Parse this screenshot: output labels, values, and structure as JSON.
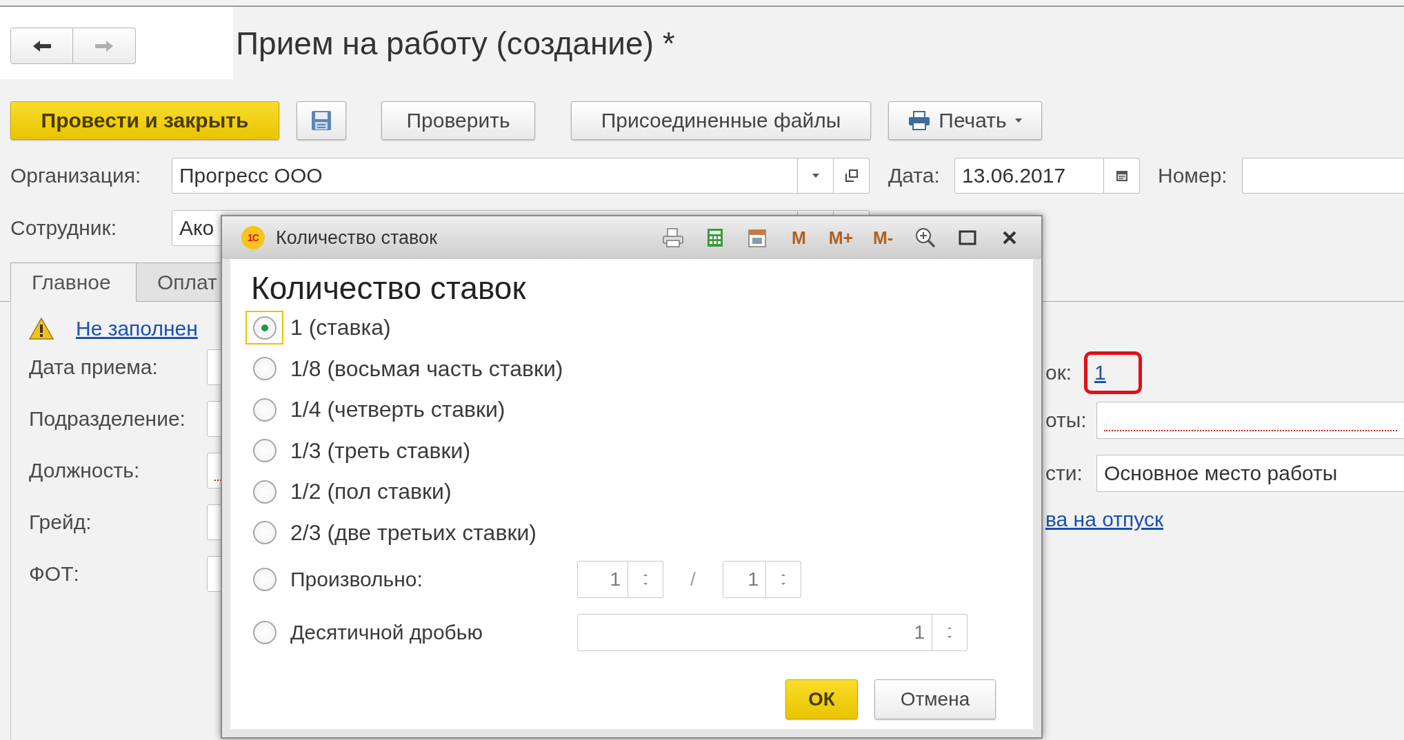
{
  "nav": [
    {
      "kind": "back",
      "disabled": false
    },
    {
      "kind": "forward",
      "disabled": true
    }
  ],
  "title": "Прием на работу (создание) *",
  "toolbar": [
    {
      "kind": "primary",
      "label": "Провести и закрыть"
    },
    {
      "kind": "save"
    },
    {
      "kind": "plain",
      "label": "Проверить"
    },
    {
      "kind": "plain",
      "label": "Присоединенные файлы"
    },
    {
      "kind": "print-menu",
      "label": "Печать"
    }
  ],
  "header": {
    "organization": {
      "label": "Организация:",
      "value": "Прогресс ООО"
    },
    "date": {
      "label": "Дата:",
      "value": "13.06.2017"
    },
    "number": {
      "label": "Номер:"
    },
    "employee": {
      "label": "Сотрудник:",
      "value": "Ако"
    }
  },
  "tabs": [
    {
      "label": "Главное",
      "selected": true
    },
    {
      "label": "Оплат",
      "selected": false
    }
  ],
  "warning": {
    "link": "Не заполнен"
  },
  "left_fields": [
    {
      "label": "Дата приема:",
      "required": false
    },
    {
      "label": "Подразделение:",
      "required": false
    },
    {
      "label": "Должность:",
      "required": true
    },
    {
      "label": "Грейд:",
      "required": false
    },
    {
      "label": "ФОТ:",
      "required": false
    }
  ],
  "right_fields": [
    {
      "kind": "link",
      "label": "ок:",
      "value": "1",
      "highlighted": true
    },
    {
      "kind": "field",
      "label": "оты:",
      "required": true
    },
    {
      "kind": "field",
      "label": "сти:",
      "value": "Основное место работы",
      "required": false
    }
  ],
  "right_link": "ва на отпуск",
  "dialog": {
    "logo": "1С",
    "title": "Количество ставок",
    "tools": [
      {
        "kind": "print"
      },
      {
        "kind": "calculator"
      },
      {
        "kind": "calendar"
      },
      {
        "kind": "memory",
        "label": "M"
      },
      {
        "kind": "memory-add",
        "label": "M+"
      },
      {
        "kind": "memory-subtract",
        "label": "M-"
      },
      {
        "kind": "zoom"
      },
      {
        "kind": "maximize"
      },
      {
        "kind": "close"
      }
    ],
    "heading": "Количество ставок",
    "options": [
      {
        "kind": "plain",
        "label": "1 (ставка)",
        "selected": true
      },
      {
        "kind": "plain",
        "label": "1/8 (восьмая часть ставки)",
        "selected": false
      },
      {
        "kind": "plain",
        "label": "1/4 (четверть ставки)",
        "selected": false
      },
      {
        "kind": "plain",
        "label": "1/3 (треть ставки)",
        "selected": false
      },
      {
        "kind": "plain",
        "label": "1/2 (пол ставки)",
        "selected": false
      },
      {
        "kind": "plain",
        "label": "2/3 (две третьих ставки)",
        "selected": false
      },
      {
        "kind": "fraction",
        "label": "Произвольно:",
        "selected": false,
        "numerator": "1",
        "separator": "/",
        "denominator": "1"
      },
      {
        "kind": "decimal",
        "label": "Десятичной дробью",
        "selected": false,
        "value": "1"
      }
    ],
    "buttons": [
      {
        "kind": "default",
        "label": "ОК"
      },
      {
        "kind": "normal",
        "label": "Отмена"
      }
    ]
  }
}
